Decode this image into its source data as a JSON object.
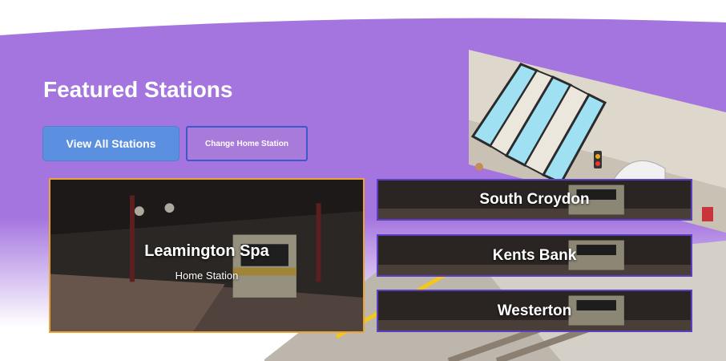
{
  "hero": {
    "title": "Featured Stations",
    "view_all_label": "View All Stations",
    "change_home_label": "Change Home Station"
  },
  "featured": {
    "name": "Leamington Spa",
    "subtitle": "Home Station"
  },
  "stations": [
    {
      "name": "South Croydon"
    },
    {
      "name": "Kents Bank"
    },
    {
      "name": "Westerton"
    }
  ],
  "colors": {
    "hero_purple": "#a474df",
    "primary_button": "#5b8fe0",
    "featured_border": "#e8a33a",
    "card_border": "#5a3fc0"
  }
}
